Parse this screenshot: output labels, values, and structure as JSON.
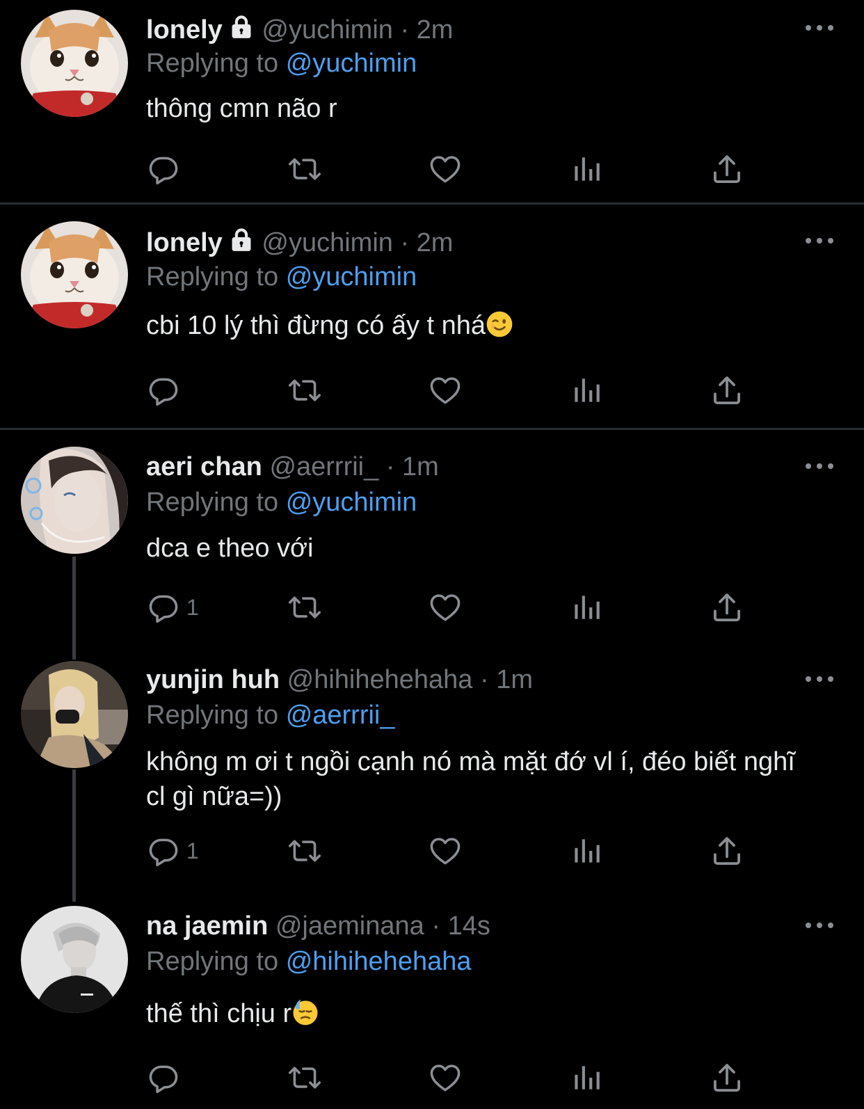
{
  "colors": {
    "background": "#000000",
    "text": "#e7e9ea",
    "muted": "#71767b",
    "link": "#4d9ff0",
    "divider": "#2a2d31"
  },
  "tweets": [
    {
      "name": "lonely",
      "handle": "@yuchimin",
      "dot": "·",
      "time": "2m",
      "replying_label": "Replying to",
      "reply_to": "@yuchimin",
      "text": "thông cmn não r",
      "reply_count": ""
    },
    {
      "name": "lonely",
      "handle": "@yuchimin",
      "dot": "·",
      "time": "2m",
      "replying_label": "Replying to",
      "reply_to": "@yuchimin",
      "text": "cbi 10 lý thì đừng có ấy t nhá",
      "reply_count": ""
    },
    {
      "name": "aeri chan",
      "handle": "@aerrrii_",
      "dot": "·",
      "time": "1m",
      "replying_label": "Replying to",
      "reply_to": "@yuchimin",
      "text": "dca e theo với",
      "reply_count": "1"
    },
    {
      "name": "yunjin huh",
      "handle": "@hihihehehaha",
      "dot": "·",
      "time": "1m",
      "replying_label": "Replying to",
      "reply_to": "@aerrrii_",
      "text": "không m ơi t ngồi cạnh nó mà mặt đớ vl í, đéo biết nghĩ cl gì nữa=))",
      "reply_count": "1"
    },
    {
      "name": "na jaemin",
      "handle": "@jaeminana",
      "dot": "·",
      "time": "14s",
      "replying_label": "Replying to",
      "reply_to": "@hihihehehaha",
      "text": "thế thì chịu r",
      "reply_count": ""
    }
  ]
}
